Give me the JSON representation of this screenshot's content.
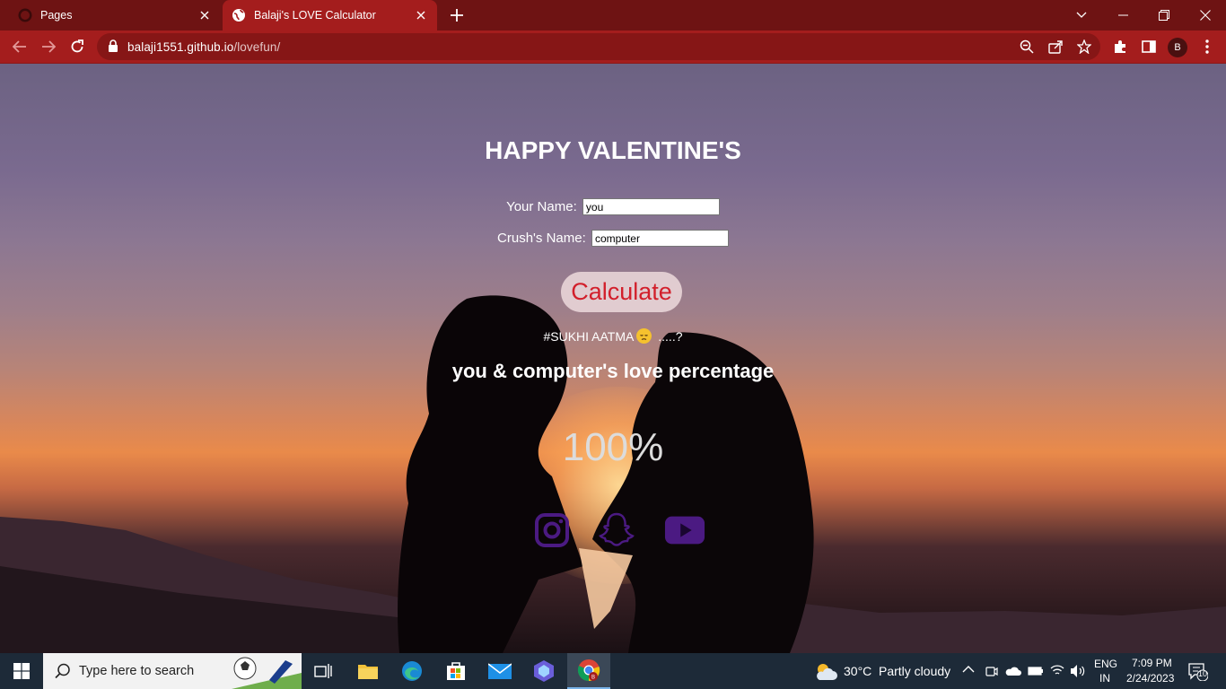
{
  "browser": {
    "tabs": [
      {
        "title": "Pages",
        "active": false
      },
      {
        "title": "Balaji's LOVE Calculator",
        "active": true
      }
    ],
    "url_host": "balaji1551.github.io",
    "url_path": "/lovefun/",
    "profile_initial": "B",
    "accent": "#a41d1d"
  },
  "page": {
    "title": "HAPPY VALENTINE'S",
    "your_name_label": "Your Name:",
    "your_name_value": "you",
    "crush_name_label": "Crush's Name:",
    "crush_name_value": "computer",
    "calculate_label": "Calculate",
    "message_prefix": "#SUKHI AATMA",
    "message_suffix": " .....?",
    "percentage_heading": "you & computer's love percentage",
    "percentage": "100%",
    "social_icons": [
      "instagram-icon",
      "snapchat-icon",
      "youtube-icon"
    ],
    "social_color": "#4b1a82"
  },
  "taskbar": {
    "search_placeholder": "Type here to search",
    "weather_temp": "30°C",
    "weather_desc": "Partly cloudy",
    "lang_top": "ENG",
    "lang_bottom": "IN",
    "time": "7:09 PM",
    "date": "2/24/2023",
    "notification_count": "10"
  }
}
